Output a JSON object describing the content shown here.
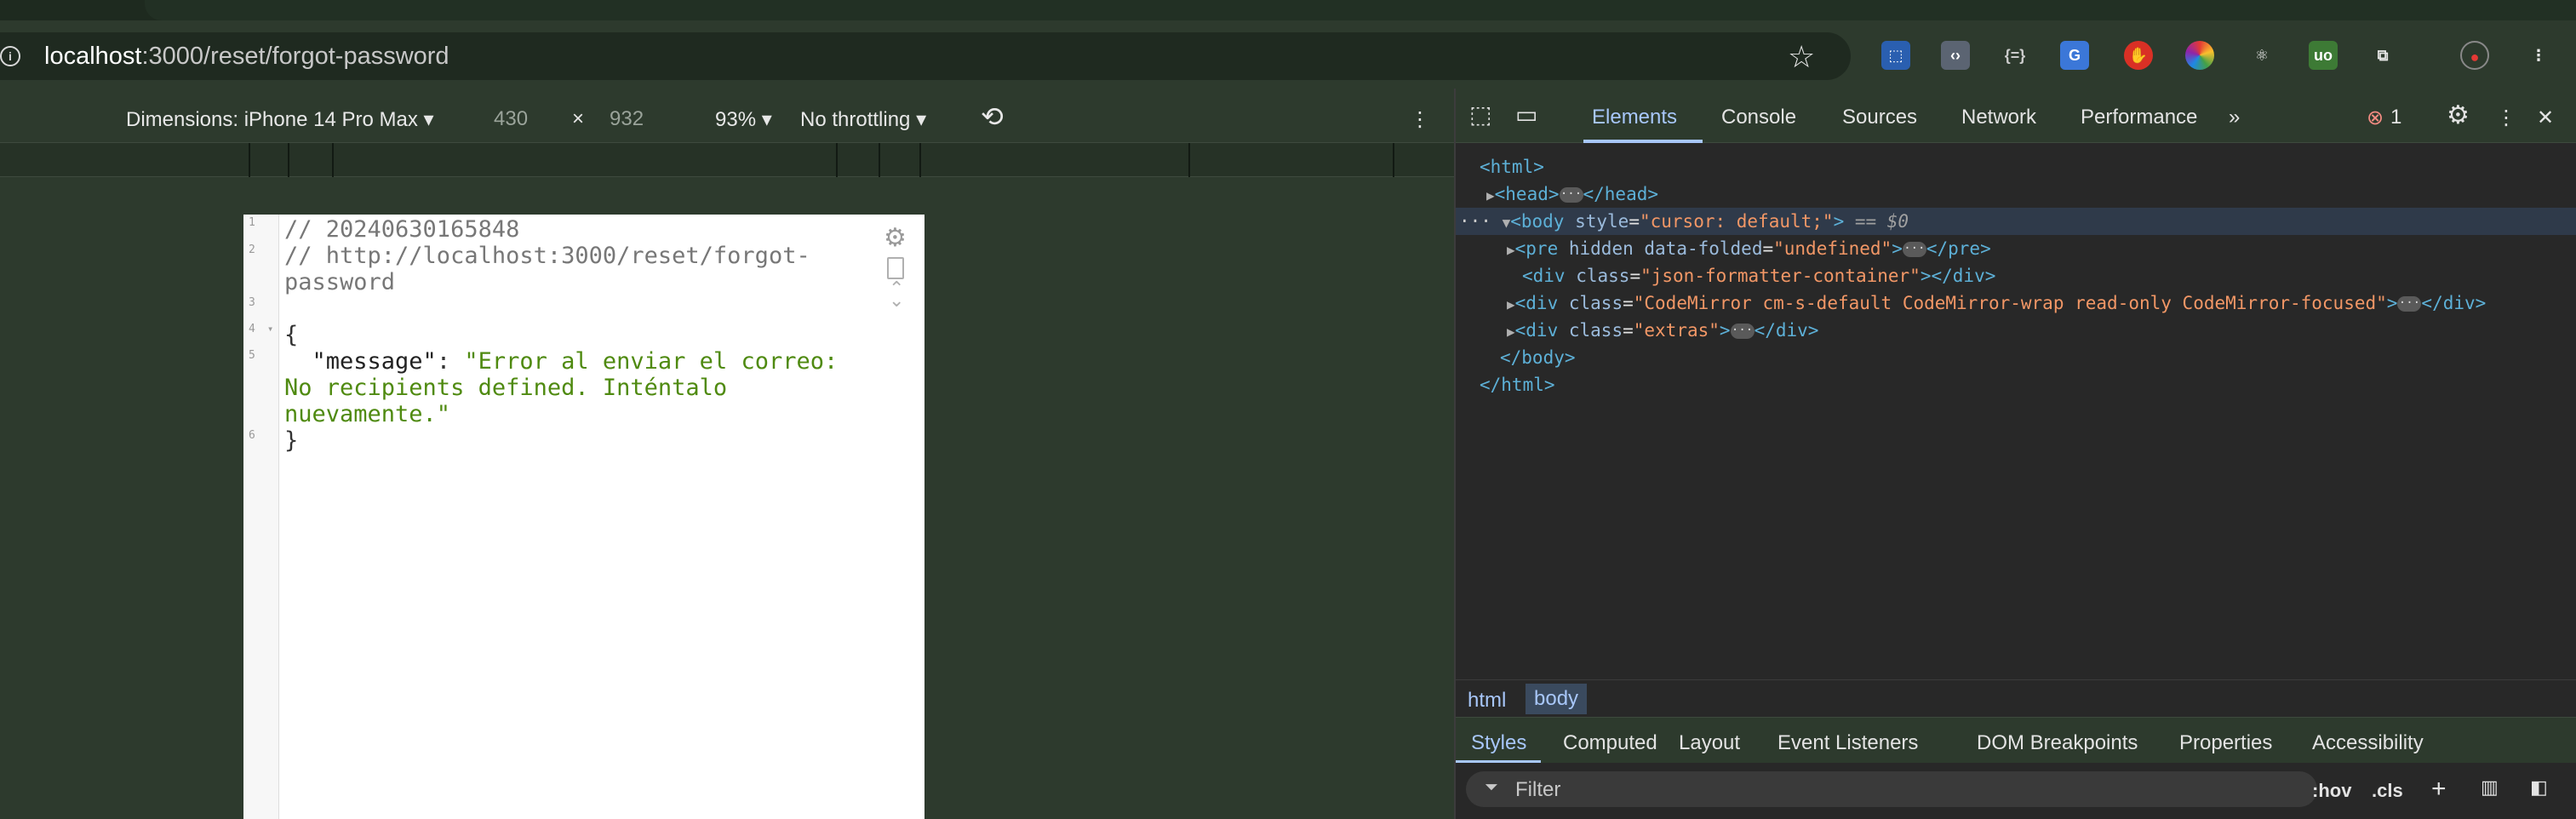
{
  "browser": {
    "url_host": "localhost",
    "url_path": ":3000/reset/forgot-password",
    "extensions": [
      "json-formatter-icon",
      "code-view-icon",
      "braces-icon",
      "translate-icon",
      "stop-hand-icon",
      "color-wheel-icon",
      "react-icon",
      "ublock-icon",
      "puzzle-icon"
    ],
    "profile": "profile-avatar"
  },
  "device_toolbar": {
    "dimensions_label": "Dimensions: iPhone 14 Pro Max",
    "width": "430",
    "times": "×",
    "height": "932",
    "zoom": "93%",
    "throttling": "No throttling"
  },
  "page": {
    "line_numbers": [
      "1",
      "2",
      "",
      "3",
      "4",
      "5",
      "",
      "",
      "6"
    ],
    "comment1": "// 20240630165848",
    "comment2a": "// http://localhost:3000/reset/forgot-",
    "comment2b": "password",
    "brace_open": "{",
    "key": "\"message\"",
    "colon": ": ",
    "value_a": "\"Error al enviar el correo:",
    "value_b": "No recipients defined. Inténtalo",
    "value_c": "nuevamente.\"",
    "brace_close": "}"
  },
  "devtools": {
    "tabs": [
      "Elements",
      "Console",
      "Sources",
      "Network",
      "Performance"
    ],
    "more": "»",
    "error_count": "1",
    "dom": {
      "html_open": "<html>",
      "head": "<head>",
      "head_close": "</head>",
      "body_tag": "<body",
      "body_attr": "style",
      "body_val": "\"cursor: default;\"",
      "body_end": ">",
      "body_eq": " == $0",
      "pre_tag": "<pre",
      "pre_attr1": "hidden",
      "pre_attr2": "data-folded",
      "pre_val": "\"undefined\"",
      "pre_close": "</pre>",
      "div1_val": "\"json-formatter-container\"",
      "div2_val": "\"CodeMirror cm-s-default CodeMirror-wrap read-only CodeMirror-focused\"",
      "div3_val": "\"extras\"",
      "div_tag": "<div",
      "class_attr": "class",
      "div_close": "</div>",
      "body_close": "</body>",
      "html_close": "</html>"
    },
    "breadcrumbs": [
      "html",
      "body"
    ],
    "subtabs": [
      "Styles",
      "Computed",
      "Layout",
      "Event Listeners",
      "DOM Breakpoints",
      "Properties",
      "Accessibility"
    ],
    "filter_placeholder": "Filter",
    "hov": ":hov",
    "cls": ".cls"
  }
}
